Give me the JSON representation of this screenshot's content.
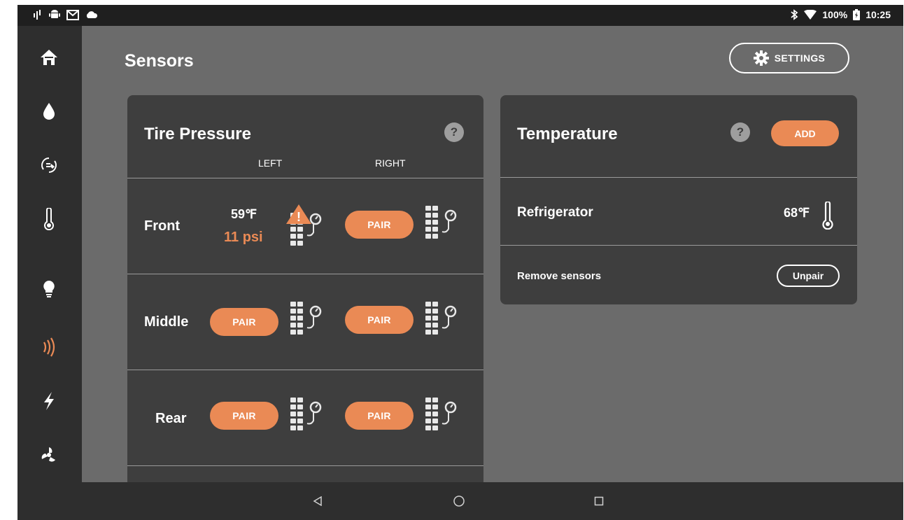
{
  "status_bar": {
    "left_icons": [
      "signal-icon",
      "android-icon",
      "gmail-icon",
      "cloud-icon"
    ],
    "right_icons": [
      "bluetooth-icon",
      "wifi-icon",
      "battery-icon"
    ],
    "battery": "100%",
    "time": "10:25"
  },
  "sidebar": {
    "items": [
      {
        "icon": "home-icon",
        "active": false
      },
      {
        "icon": "water-drop-icon",
        "active": false
      },
      {
        "icon": "brake-icon",
        "active": false
      },
      {
        "icon": "thermometer-icon",
        "active": false
      },
      {
        "icon": "lightbulb-icon",
        "active": false
      },
      {
        "icon": "sensors-wave-icon",
        "active": true
      },
      {
        "icon": "lightning-icon",
        "active": false
      },
      {
        "icon": "fan-icon",
        "active": false
      }
    ]
  },
  "header": {
    "title": "Sensors",
    "settings_label": "SETTINGS"
  },
  "tire": {
    "title": "Tire Pressure",
    "help": "?",
    "left_label": "LEFT",
    "right_label": "RIGHT",
    "pair_label": "PAIR",
    "rows": {
      "front": {
        "label": "Front",
        "left_temp": "59℉",
        "left_psi": "11 psi",
        "warning": "!"
      },
      "middle": {
        "label": "Middle"
      },
      "rear": {
        "label": "Rear"
      }
    }
  },
  "temperature": {
    "title": "Temperature",
    "help": "?",
    "add_label": "ADD",
    "sensor_name": "Refrigerator",
    "sensor_value": "68℉",
    "remove_label": "Remove sensors",
    "unpair_label": "Unpair"
  },
  "navbar": {
    "buttons": [
      "back-icon",
      "home-circle-icon",
      "recents-icon"
    ]
  },
  "colors": {
    "accent": "#ea8a55",
    "card": "#3e3e3e",
    "background": "#6b6b6b",
    "sidebar": "#2e2e2e"
  }
}
